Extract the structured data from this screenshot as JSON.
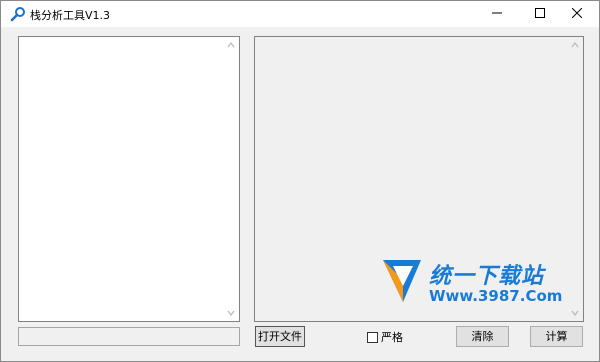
{
  "window": {
    "title": "栈分析工具V1.3",
    "icon": "magnifier-icon"
  },
  "title_controls": {
    "minimize_icon": "minimize-icon",
    "maximize_icon": "maximize-icon",
    "close_icon": "close-icon"
  },
  "left_panel": {
    "scroll_up_icon": "scroll-up-arrow",
    "scroll_down_icon": "scroll-down-arrow"
  },
  "right_panel": {
    "scroll_up_icon": "scroll-up-arrow",
    "scroll_down_icon": "scroll-down-arrow"
  },
  "toolbar": {
    "open_file_label": "打开文件",
    "strict_label": "严格",
    "strict_checked": false,
    "clear_label": "清除",
    "calculate_label": "计算"
  },
  "watermark": {
    "title": "统一下载站",
    "url": "Www.3987.Com"
  },
  "colors": {
    "window_bg": "#f0f0f0",
    "button_bg": "#e1e1e1",
    "watermark_blue": "#1a7bd6",
    "watermark_orange": "#f39a1b"
  }
}
